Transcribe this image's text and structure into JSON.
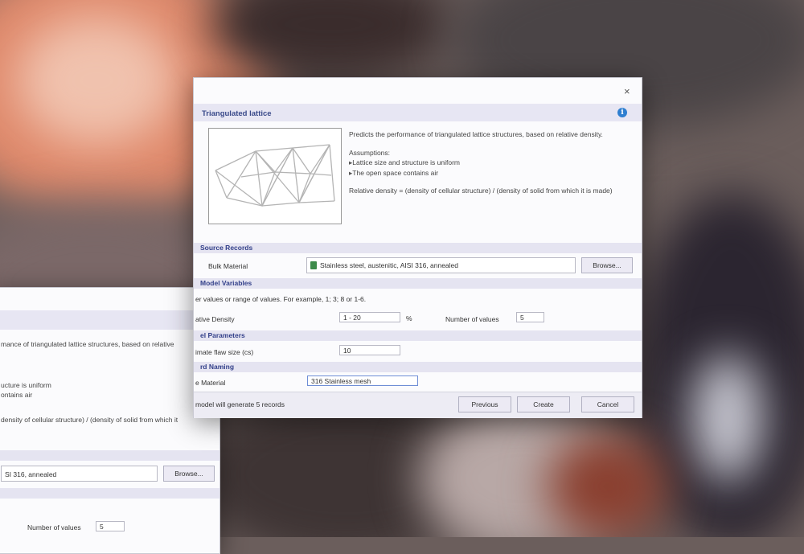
{
  "colors": {
    "accent": "#3a4a8a",
    "section_bg": "#e5e4f1",
    "info": "#2f7fd0"
  },
  "dialog_main": {
    "close_glyph": "×",
    "title": "Triangulated lattice",
    "info_glyph": "i",
    "description": "Predicts the performance of triangulated lattice structures, based on relative density.",
    "assumptions_heading": "Assumptions:",
    "assumptions": [
      "Lattice size and structure is uniform",
      "The open space contains air"
    ],
    "relative_density_note": "Relative density = (density of cellular structure) / (density of solid from which it is made)",
    "source_records": {
      "heading": "Source Records",
      "bulk_material_label": "Bulk Material",
      "bulk_material_value": "Stainless steel, austenitic, AISI 316, annealed",
      "browse_label": "Browse..."
    },
    "model_variables": {
      "heading": "Model Variables",
      "hint": "er values or range of values. For example, 1; 3; 8 or 1-6.",
      "density_label": "ative Density",
      "density_value": "1 - 20",
      "density_unit": "%",
      "num_values_label": "Number of values",
      "num_values_value": "5"
    },
    "model_parameters": {
      "heading": "el Parameters",
      "flaw_label": "imate flaw size (cs)",
      "flaw_value": "10"
    },
    "record_naming": {
      "heading": "rd Naming",
      "material_label": "e Material",
      "material_value": "316 Stainless mesh"
    },
    "footer": {
      "status": "model will generate 5 records",
      "previous_label": "Previous",
      "create_label": "Create",
      "cancel_label": "Cancel"
    }
  },
  "dialog_back": {
    "close_glyph": "×",
    "info_glyph": "i",
    "desc_line1": "mance of triangulated lattice structures, based on relative",
    "assump1": "ucture is uniform",
    "assump2": "ontains air",
    "note1": "density of cellular structure) / (density of solid from which it",
    "bulk_value": "SI 316, annealed",
    "browse_label": "Browse...",
    "num_values_label": "Number of values",
    "num_values_value": "5"
  }
}
